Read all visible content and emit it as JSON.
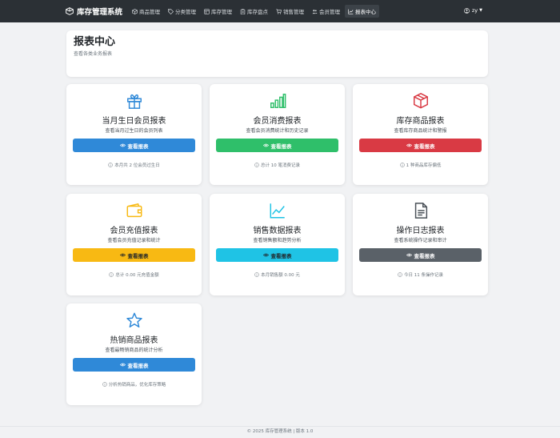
{
  "app": {
    "brand": "库存管理系统"
  },
  "nav": [
    {
      "label": "商品管理",
      "icon": "box-icon"
    },
    {
      "label": "分类管理",
      "icon": "tag-icon"
    },
    {
      "label": "库存管理",
      "icon": "warehouse-icon"
    },
    {
      "label": "库存盘点",
      "icon": "clipboard-icon"
    },
    {
      "label": "销售管理",
      "icon": "cart-icon"
    },
    {
      "label": "会员管理",
      "icon": "people-icon"
    },
    {
      "label": "报表中心",
      "icon": "chart-icon"
    }
  ],
  "user": {
    "name": "zy"
  },
  "header": {
    "title": "报表中心",
    "subtitle": "查看各类业务报表"
  },
  "cards": [
    {
      "title": "当月生日会员报表",
      "desc": "查看当月过生日的会员列表",
      "button": "查看报表",
      "note": "本月共 2 位会员过生日",
      "icon": "gift-icon",
      "color": "#2f89d8"
    },
    {
      "title": "会员消费报表",
      "desc": "查看会员消费统计和历史记录",
      "button": "查看报表",
      "note": "总计 10 笔消费记录",
      "icon": "bar-chart-icon",
      "color": "#2fbf6a"
    },
    {
      "title": "库存商品报表",
      "desc": "查看库存商品统计和警报",
      "button": "查看报表",
      "note": "1 种商品库存偏低",
      "icon": "box-icon",
      "color": "#d93a44"
    },
    {
      "title": "会员充值报表",
      "desc": "查看会员充值记录和统计",
      "button": "查看报表",
      "note": "总计 0.00 元充值金额",
      "icon": "wallet-icon",
      "color": "#f8b913"
    },
    {
      "title": "销售数据报表",
      "desc": "查看销售额和趋势分析",
      "button": "查看报表",
      "note": "本月销售额 0.00 元",
      "icon": "line-chart-icon",
      "color": "#1fc3e5"
    },
    {
      "title": "操作日志报表",
      "desc": "查看系统操作记录和审计",
      "button": "查看报表",
      "note": "今日 11 条操作记录",
      "icon": "file-text-icon",
      "color": "#5a6168"
    },
    {
      "title": "热销商品报表",
      "desc": "查看最畅销商品的统计分析",
      "button": "查看报表",
      "note": "分析热销商品，优化库存策略",
      "icon": "star-icon",
      "color": "#2f89d8"
    }
  ],
  "footer": {
    "text": "© 2025 库存管理系统 | 版本 1.0"
  }
}
